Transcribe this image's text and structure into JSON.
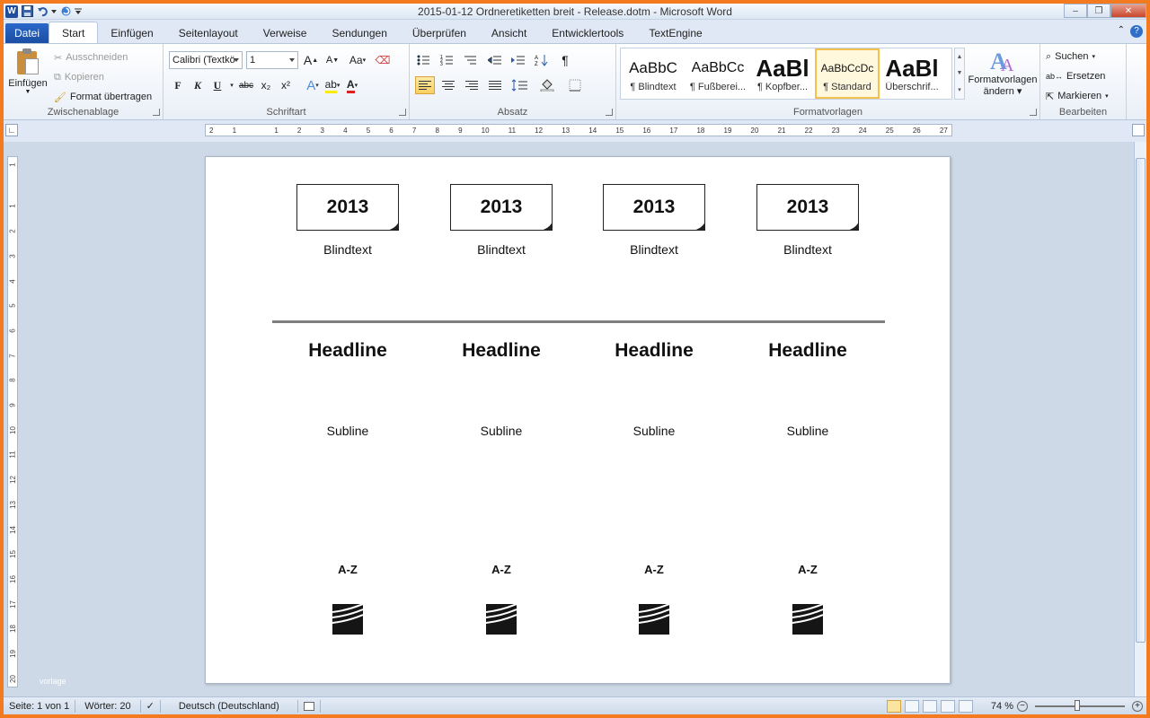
{
  "window": {
    "title": "2015-01-12 Ordneretiketten breit - Release.dotm  -  Microsoft Word",
    "app_icon_letter": "W"
  },
  "tabs": {
    "file_label": "Datei",
    "items": [
      "Start",
      "Einfügen",
      "Seitenlayout",
      "Verweise",
      "Sendungen",
      "Überprüfen",
      "Ansicht",
      "Entwicklertools",
      "TextEngine"
    ],
    "active": "Start"
  },
  "ribbon": {
    "clipboard": {
      "label": "Zwischenablage",
      "paste": "Einfügen",
      "cut": "Ausschneiden",
      "copy": "Kopieren",
      "format_painter": "Format übertragen"
    },
    "font": {
      "label": "Schriftart",
      "font_name": "Calibri (Textkö",
      "font_size": "1",
      "bold": "F",
      "italic": "K",
      "underline": "U",
      "strike": "abc",
      "subscript": "x₂",
      "superscript": "x²",
      "grow": "A",
      "shrink": "A",
      "case": "Aa",
      "font_color_letter": "A",
      "text_effect_letter": "A"
    },
    "paragraph": {
      "label": "Absatz",
      "pilcrow": "¶"
    },
    "styles": {
      "label": "Formatvorlagen",
      "items": [
        {
          "sample": "AaBbC",
          "name": "¶ Blindtext"
        },
        {
          "sample": "AaBbCc",
          "name": "¶ Fußberei..."
        },
        {
          "sample": "AaBl",
          "name": "¶ Kopfber..."
        },
        {
          "sample": "AaBbCcDc",
          "name": "¶ Standard"
        },
        {
          "sample": "AaBl",
          "name": "Überschrif..."
        }
      ],
      "selected_index": 3,
      "change_label_1": "Formatvorlagen",
      "change_label_2": "ändern"
    },
    "editing": {
      "label": "Bearbeiten",
      "find": "Suchen",
      "replace": "Ersetzen",
      "select": "Markieren"
    }
  },
  "ruler": {
    "h_ticks": [
      "2",
      "1",
      "",
      "1",
      "2",
      "3",
      "4",
      "5",
      "6",
      "7",
      "8",
      "9",
      "10",
      "11",
      "12",
      "13",
      "14",
      "15",
      "16",
      "17",
      "18",
      "19",
      "20",
      "21",
      "22",
      "23",
      "24",
      "25",
      "26",
      "27"
    ],
    "v_ticks": [
      "1",
      "",
      "1",
      "2",
      "3",
      "4",
      "5",
      "6",
      "7",
      "8",
      "9",
      "10",
      "11",
      "12",
      "13",
      "14",
      "15",
      "16",
      "17",
      "18",
      "19",
      "20"
    ]
  },
  "document": {
    "labels": [
      {
        "year": "2013",
        "blindtext": "Blindtext",
        "headline": "Headline",
        "subline": "Subline",
        "az": "A-Z"
      },
      {
        "year": "2013",
        "blindtext": "Blindtext",
        "headline": "Headline",
        "subline": "Subline",
        "az": "A-Z"
      },
      {
        "year": "2013",
        "blindtext": "Blindtext",
        "headline": "Headline",
        "subline": "Subline",
        "az": "A-Z"
      },
      {
        "year": "2013",
        "blindtext": "Blindtext",
        "headline": "Headline",
        "subline": "Subline",
        "az": "A-Z"
      }
    ],
    "watermark": "vorlage"
  },
  "statusbar": {
    "page": "Seite: 1 von 1",
    "words": "Wörter: 20",
    "language": "Deutsch (Deutschland)",
    "zoom": "74 %"
  },
  "colors": {
    "frame": "#f47a20",
    "file_tab": "#1b4ea3",
    "selected_style_border": "#f2c14e"
  }
}
